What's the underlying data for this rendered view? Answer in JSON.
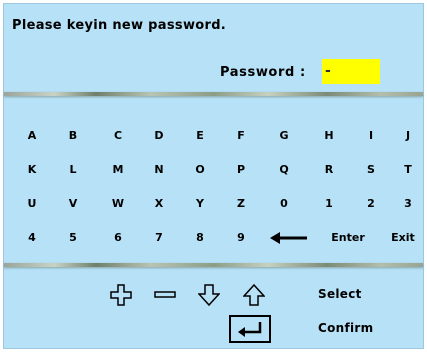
{
  "prompt": "Please keyin new password.",
  "password": {
    "label": "Password :",
    "value": "-"
  },
  "keyboard": {
    "rows": [
      [
        "A",
        "B",
        "C",
        "D",
        "E",
        "F",
        "G",
        "H",
        "I",
        "J"
      ],
      [
        "K",
        "L",
        "M",
        "N",
        "O",
        "P",
        "Q",
        "R",
        "S",
        "T"
      ],
      [
        "U",
        "V",
        "W",
        "X",
        "Y",
        "Z",
        "0",
        "1",
        "2",
        "3"
      ],
      [
        "4",
        "5",
        "6",
        "7",
        "8",
        "9",
        "backspace-arrow",
        "Enter",
        "Exit"
      ]
    ]
  },
  "controls": {
    "icons": [
      "plus-icon",
      "minus-icon",
      "down-arrow-icon",
      "up-arrow-icon",
      "enter-key-icon"
    ],
    "select_label": "Select",
    "confirm_label": "Confirm"
  },
  "colors": {
    "background": "#b6e1f6",
    "input": "#ffff00"
  }
}
